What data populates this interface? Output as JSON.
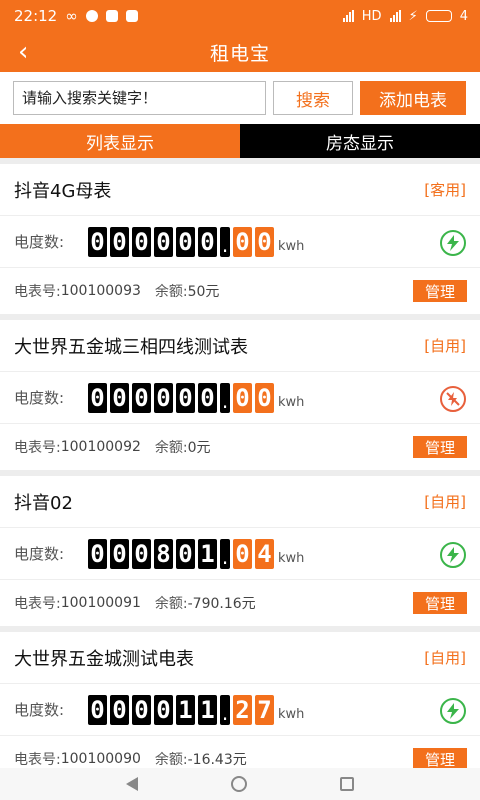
{
  "status": {
    "time": "22:12",
    "battery": "4"
  },
  "header": {
    "title": "租电宝"
  },
  "search": {
    "placeholder": "请输入搜索关键字！",
    "search_label": "搜索",
    "add_label": "添加电表"
  },
  "tabs": [
    {
      "label": "列表显示",
      "active": true
    },
    {
      "label": "房态显示",
      "active": false
    }
  ],
  "reading_label": "电度数:",
  "unit": "kwh",
  "meter_no_label": "电表号:",
  "balance_label": "余额:",
  "manage_label": "管理",
  "colors": {
    "accent": "#f3701c",
    "power_on": "#3bb54a",
    "power_off": "#e8603c"
  },
  "meters": [
    {
      "name": "抖音4G母表",
      "tag": "[客用]",
      "int_digits": [
        "0",
        "0",
        "0",
        "0",
        "0",
        "0"
      ],
      "dec_digits": [
        "0",
        "0"
      ],
      "meter_no": "100100093",
      "balance": "50元",
      "power": "on"
    },
    {
      "name": "大世界五金城三相四线测试表",
      "tag": "[自用]",
      "int_digits": [
        "0",
        "0",
        "0",
        "0",
        "0",
        "0"
      ],
      "dec_digits": [
        "0",
        "0"
      ],
      "meter_no": "100100092",
      "balance": "0元",
      "power": "off"
    },
    {
      "name": "抖音02",
      "tag": "[自用]",
      "int_digits": [
        "0",
        "0",
        "0",
        "8",
        "0",
        "1"
      ],
      "dec_digits": [
        "0",
        "4"
      ],
      "meter_no": "100100091",
      "balance": "-790.16元",
      "power": "on"
    },
    {
      "name": "大世界五金城测试电表",
      "tag": "[自用]",
      "int_digits": [
        "0",
        "0",
        "0",
        "0",
        "1",
        "1"
      ],
      "dec_digits": [
        "2",
        "7"
      ],
      "meter_no": "100100090",
      "balance": "-16.43元",
      "power": "on"
    }
  ]
}
